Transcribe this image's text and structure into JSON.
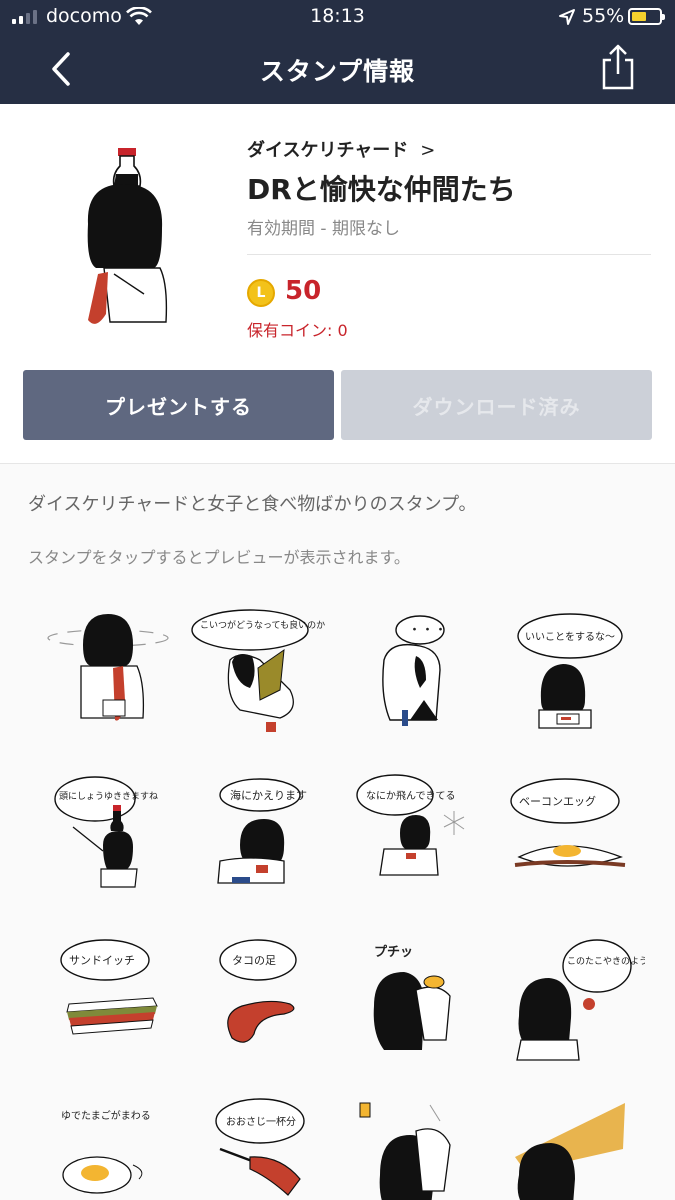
{
  "status_bar": {
    "carrier": "docomo",
    "time": "18:13",
    "battery_percent": "55%",
    "battery_level": 0.55
  },
  "nav": {
    "title": "スタンプ情報",
    "back_icon": "chevron-left-icon",
    "share_icon": "share-icon"
  },
  "sticker": {
    "author": "ダイスケリチャード",
    "title": "DRと愉快な仲間たち",
    "period": "有効期間 - 期限なし",
    "coin_symbol": "L",
    "price": "50",
    "owned_coins": "保有コイン: 0"
  },
  "buttons": {
    "present": "プレゼントする",
    "downloaded": "ダウンロード済み"
  },
  "description": "ダイスケリチャードと女子と食べ物ばかりのスタンプ。",
  "preview_hint": "スタンプをタップするとプレビューが表示されます。",
  "grid_bubbles": {
    "s2": "こいつがどうなっても良いのか",
    "s3": "・・・",
    "s4": "いいことをするな～",
    "s5": "頭にしょうゆききますね",
    "s6": "海にかえります",
    "s7": "なにか飛んできてる",
    "s8": "ベーコンエッグ",
    "s9": "サンドイッチ",
    "s10": "タコの足",
    "s11": "プチッ",
    "s12": "このたこやきのように",
    "s13": "ゆでたまごがまわる",
    "s14": "おおさじ一杯分"
  },
  "colors": {
    "nav_bg": "#262f44",
    "present_btn": "#5f6880",
    "downloaded_btn": "#ccd0d8",
    "price_red": "#c8242b",
    "coin_gold": "#f3c21a"
  }
}
